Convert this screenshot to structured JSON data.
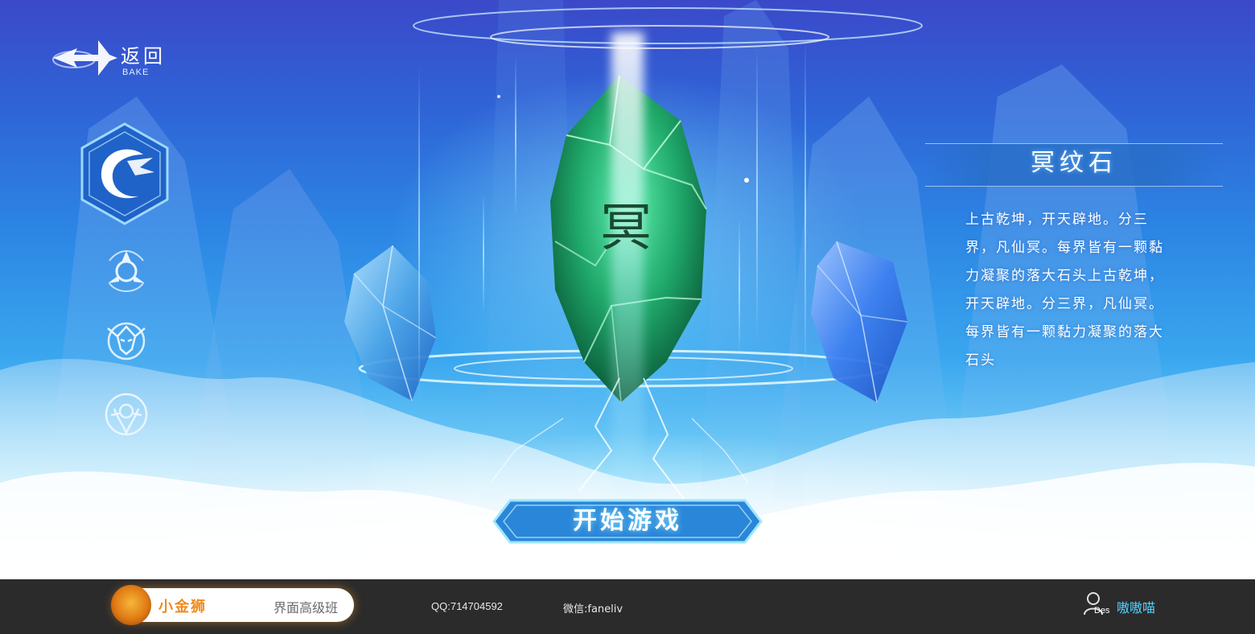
{
  "logo": {
    "title": "返回",
    "subtitle": "BAKE",
    "icon": "back-arrow-icon"
  },
  "nav": {
    "items": [
      {
        "icon": "dragon-crest-icon",
        "active": true
      },
      {
        "icon": "tri-blade-emblem-icon",
        "active": false
      },
      {
        "icon": "winged-mask-emblem-icon",
        "active": false
      },
      {
        "icon": "orb-shield-emblem-icon",
        "active": false
      }
    ]
  },
  "crystal": {
    "glyph": "冥",
    "name": "冥纹石"
  },
  "info": {
    "title": "冥纹石",
    "description": "上古乾坤，开天辟地。分三界，凡仙冥。每界皆有一颗黏力凝聚的落大石头上古乾坤，开天辟地。分三界，凡仙冥。每界皆有一颗黏力凝聚的落大石头"
  },
  "start_button": {
    "label": "开始游戏"
  },
  "footer": {
    "brand_name": "小金狮",
    "brand_class": "界面高级班",
    "qq": "QQ:714704592",
    "wechat": "微信:faneliv",
    "user_tag": "Des",
    "user_name": "嗷嗷喵"
  },
  "colors": {
    "sky_top": "#3b49c9",
    "sky_mid": "#2c86e4",
    "crystal_green": "#1fa86a",
    "panel_blue": "#286ec8",
    "footer_bg": "#2b2b2b",
    "brand_orange": "#f08a1c",
    "user_cyan": "#53d4ff"
  }
}
